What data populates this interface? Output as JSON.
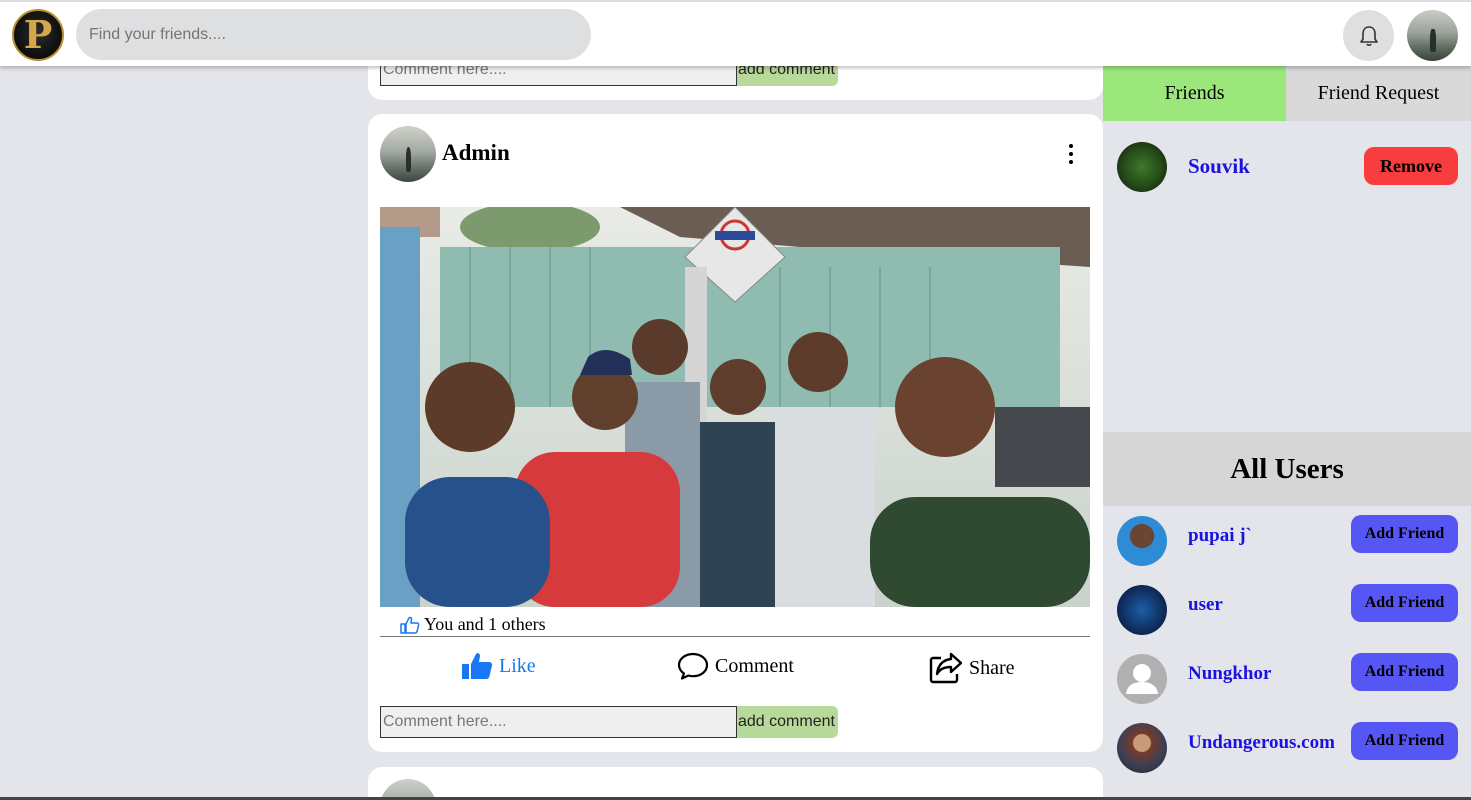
{
  "header": {
    "logo_letter": "P",
    "search_placeholder": "Find your friends....",
    "notification_icon": "bell-icon"
  },
  "feed": {
    "previous_post": {
      "comment_placeholder": "Comment here....",
      "add_comment_label": "add comment"
    },
    "post": {
      "author": "Admin",
      "likes_text": "You and 1 others",
      "actions": {
        "like": "Like",
        "comment": "Comment",
        "share": "Share"
      },
      "comment_placeholder": "Comment here....",
      "add_comment_label": "add comment"
    }
  },
  "right_panel": {
    "tabs": {
      "friends": "Friends",
      "requests": "Friend Request"
    },
    "friends": [
      {
        "name": "Souvik",
        "action": "Remove"
      }
    ],
    "all_users_title": "All Users",
    "users": [
      {
        "name": "pupai j`",
        "action": "Add Friend"
      },
      {
        "name": "user",
        "action": "Add Friend"
      },
      {
        "name": "Nungkhor",
        "action": "Add Friend"
      },
      {
        "name": "Undangerous.com",
        "action": "Add Friend"
      }
    ]
  },
  "colors": {
    "accent_blue": "#1877f2",
    "friends_tab": "#9ce77c",
    "remove_button": "#f73d3d",
    "add_friend_button": "#5656f5",
    "username_link": "#1a12e0"
  }
}
